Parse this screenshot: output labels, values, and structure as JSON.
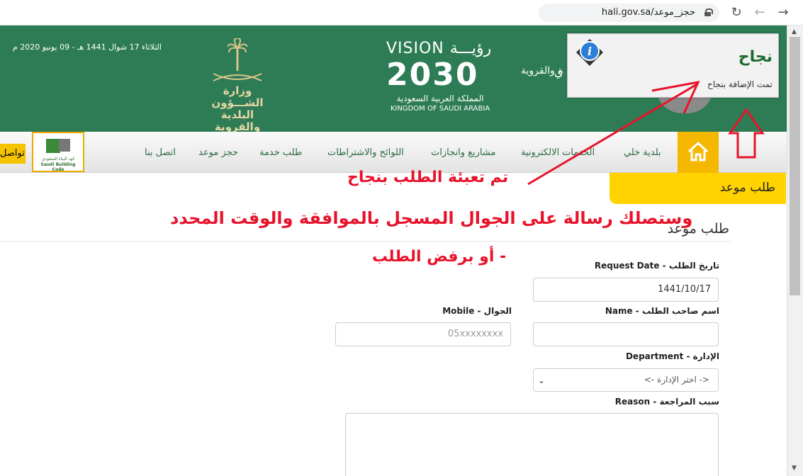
{
  "browser": {
    "url": "hali.gov.sa/حجز_موعد",
    "back_icon": "arrow-left-icon",
    "forward_icon": "arrow-right-icon",
    "reload_icon": "reload-icon"
  },
  "header": {
    "date": "الثلاثاء 17 شوال 1441 هـ - 09 يونيو 2020 م",
    "ministry_name_line1": "وزارة الشـــؤون",
    "ministry_name_line2": "البلدية والقروية",
    "vision_top": "VISION رؤيـــة",
    "vision_year": "2030",
    "vision_ar": "المملكة العربية السعودية",
    "vision_en": "KINGDOM OF SAUDI ARABIA",
    "partial_title": "ة والقروية",
    "partial_char": "ي"
  },
  "popup": {
    "title": "نجاح",
    "message": "تمت الإضافة بنجاح"
  },
  "nav": {
    "items": [
      "بلدية خلي",
      "الخدمات الالكترونية",
      "مشاريع وانجازات",
      "اللوائح والاشتراطات",
      "طلب خدمة",
      "حجز موعد",
      "اتصل بنا"
    ],
    "contact_tab": "تواصل",
    "sbc_line1": "كود البناء السعودي",
    "sbc_line2": "Saudi Building Code"
  },
  "breadcrumb": "طلب موعد",
  "annotations": {
    "line1": "تم تعبئة الطلب بنجاح",
    "line2": "وستصلك رسالة على الجوال المسجل بالموافقة والوقت المحدد",
    "line3": "- أو برفض الطلب"
  },
  "form": {
    "title": "طلب موعد",
    "request_date_label": "تاريخ الطلب - Request Date",
    "request_date_value": "1441/10/17",
    "name_label": "اسم صاحب الطلب - Name",
    "name_value": "",
    "mobile_label": "الجوال - Mobile",
    "mobile_placeholder": "05xxxxxxxx",
    "department_label": "الإدارة - Department",
    "department_selected": "<- اختر الإدارة ->",
    "reason_label": "سبب المراجعة - Reason",
    "reason_value": ""
  },
  "colors": {
    "header_green": "#2d7c55",
    "accent_yellow": "#ffd200",
    "annotation_red": "#e8132b",
    "success_green": "#1d6b2e"
  }
}
